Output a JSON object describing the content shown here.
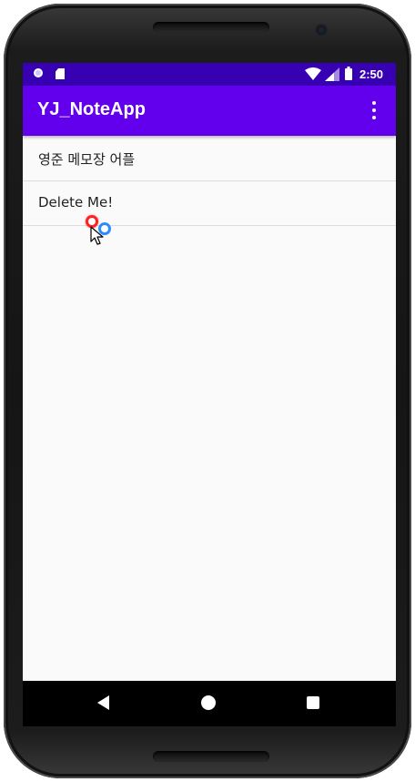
{
  "status_bar": {
    "time": "2:50"
  },
  "app_bar": {
    "title": "YJ_NoteApp",
    "menu_icon": "more-vert-icon"
  },
  "notes": [
    {
      "title": "영준 메모장 어플"
    },
    {
      "title": "Delete Me!"
    }
  ],
  "navigation": {
    "back_icon": "back-triangle-icon",
    "home_icon": "home-circle-icon",
    "recents_icon": "recents-square-icon"
  },
  "colors": {
    "status_bar": "#3700b3",
    "app_bar": "#6200ee",
    "background": "#fafafa",
    "divider": "#dcdcdc",
    "touch_primary": "#ff2222",
    "touch_secondary": "#2a8cff"
  }
}
